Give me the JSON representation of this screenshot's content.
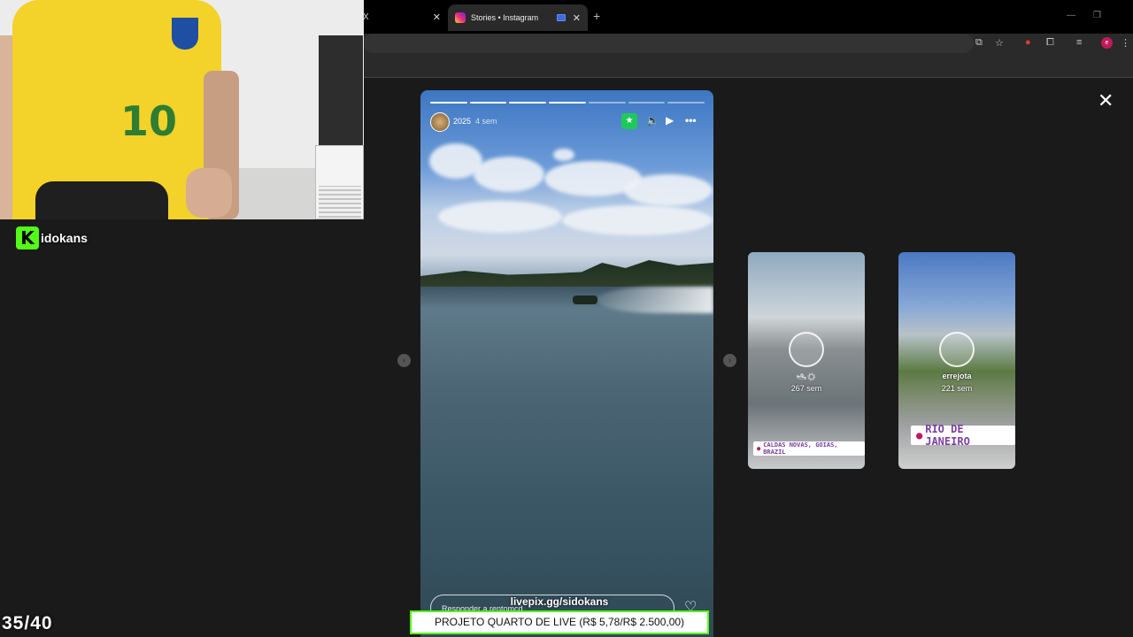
{
  "browser": {
    "prev_tab_label": "X",
    "active_tab_title": "Stories • Instagram",
    "new_tab_symbol": "+",
    "window_controls": [
      "—",
      "❐"
    ],
    "profile_initial": "e"
  },
  "story": {
    "username": "2025",
    "time_ago": "4 sem",
    "progress": {
      "total": 7,
      "completed": 4
    },
    "reply_placeholder": "Responder a rentomcd...",
    "icons": [
      "star-icon",
      "speaker-icon",
      "play-icon",
      "more-icon",
      "heart-icon",
      "close-icon"
    ]
  },
  "side_stories": [
    {
      "emoji": "🛥☀",
      "time_ago": "267 sem",
      "location": "CALDAS NOVAS, GOIAS, BRAZIL"
    },
    {
      "name": "errejota",
      "time_ago": "221 sem",
      "location": "RIO DE JANEIRO"
    }
  ],
  "overlay": {
    "channel_logo": "K",
    "channel_name": "idokans",
    "counter": "35/40",
    "donation_link": "livepix.gg/sidokans",
    "goal_text": "PROJETO QUARTO DE LIVE (R$ 5,78/R$ 2.500,00)",
    "jersey_number": "10"
  },
  "colors": {
    "kick_green": "#53fc18",
    "close_friends_green": "#1ec95a",
    "instagram_gradient": [
      "#f9ce34",
      "#ee2a7b",
      "#6228d7"
    ]
  }
}
